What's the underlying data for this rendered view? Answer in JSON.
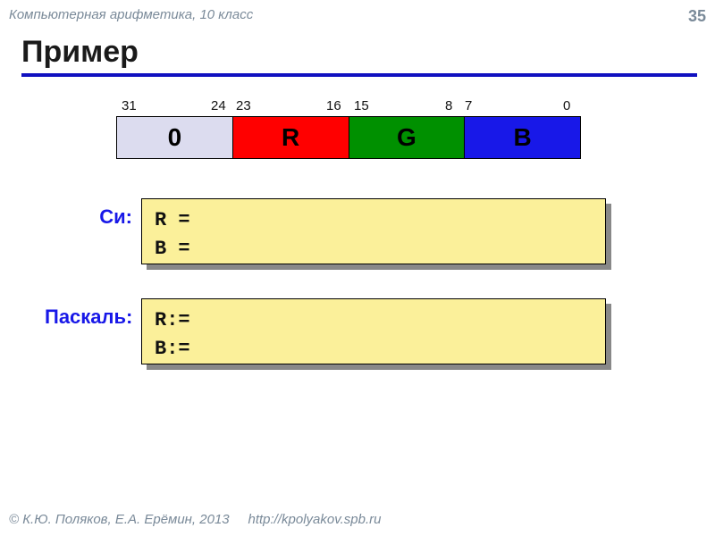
{
  "header": {
    "subject": "Компьютерная арифметика, 10 класс",
    "page_number": "35"
  },
  "title": "Пример",
  "diagram": {
    "bits": {
      "b31": "31",
      "b24": "24",
      "b23": "23",
      "b16": "16",
      "b15": "15",
      "b8": "8",
      "b7": "7",
      "b0": "0"
    },
    "cells": {
      "c0": "0",
      "r": "R",
      "g": "G",
      "b": "B"
    },
    "colors": {
      "c0": "#dcdcef",
      "r": "#ff0000",
      "g": "#009000",
      "b": "#1818e8"
    }
  },
  "code": {
    "c_label": "Си:",
    "c_line1": "R =",
    "c_line2": "B =",
    "pascal_label": "Паскаль:",
    "pascal_line1": "R:=",
    "pascal_line2": "B:="
  },
  "footer": {
    "copyright": "© К.Ю. Поляков, Е.А. Ерёмин, 2013",
    "url": "http://kpolyakov.spb.ru"
  }
}
